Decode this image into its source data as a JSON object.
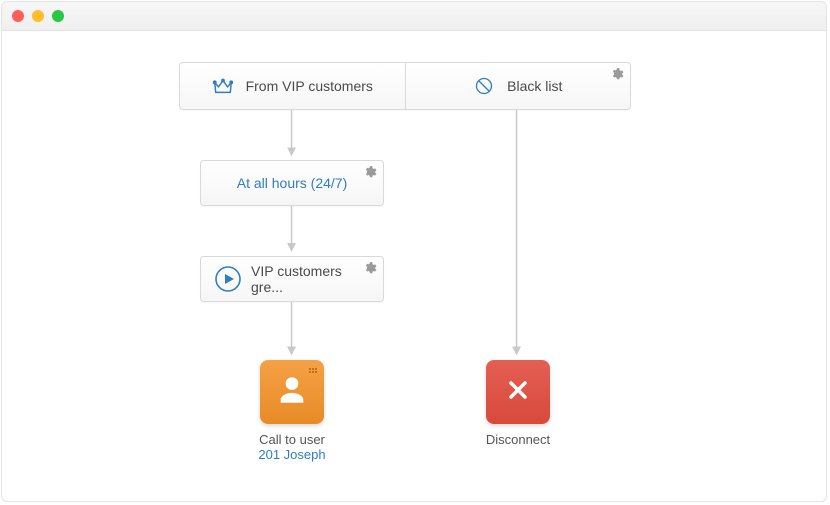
{
  "top": {
    "left_label": "From VIP customers",
    "right_label": "Black list"
  },
  "schedule": {
    "label": "At all hours (24/7)"
  },
  "greeting": {
    "label": "VIP customers gre..."
  },
  "action_left": {
    "title": "Call to user",
    "subtitle": "201 Joseph"
  },
  "action_right": {
    "title": "Disconnect"
  }
}
